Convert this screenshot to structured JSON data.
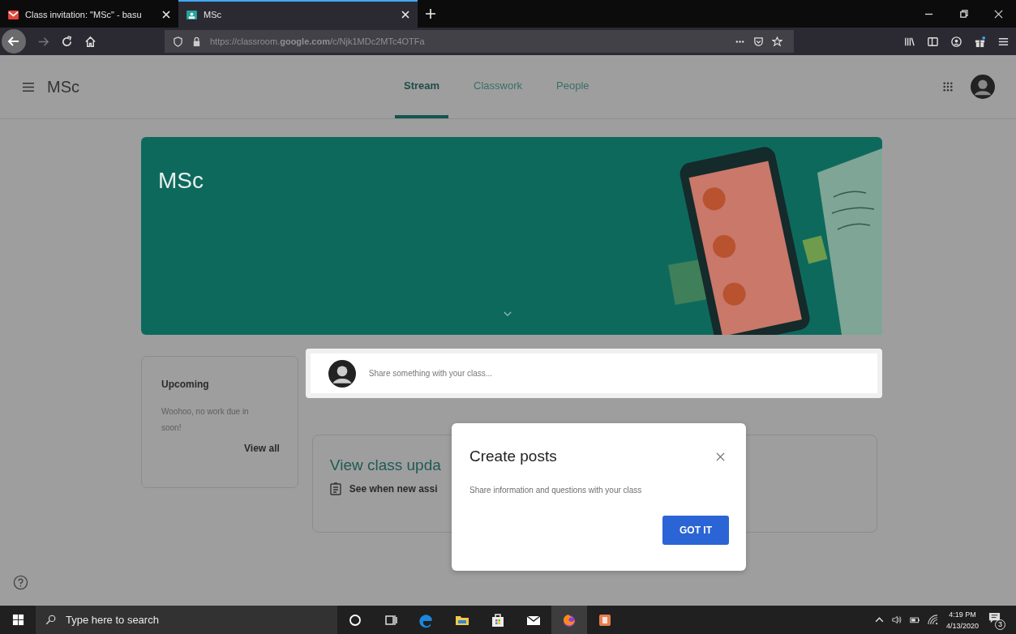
{
  "browser": {
    "tabs": [
      {
        "title": "Class invitation: \"MSc\" - basu",
        "selected": false
      },
      {
        "title": "MSc",
        "selected": true
      }
    ],
    "url": "https://classroom.**google.com**/c/Njk1MDc2MTc4OTFa"
  },
  "header": {
    "class_name": "MSc",
    "tabs": [
      {
        "label": "Stream",
        "selected": true
      },
      {
        "label": "Classwork",
        "selected": false
      },
      {
        "label": "People",
        "selected": false
      }
    ]
  },
  "banner": {
    "title": "MSc"
  },
  "upcoming": {
    "title": "Upcoming",
    "message": "Woohoo, no work due in soon!",
    "link": "View all"
  },
  "share": {
    "placeholder": "Share something with your class..."
  },
  "updates": {
    "title": "View class upda",
    "text": "See when new assi"
  },
  "dialog": {
    "title": "Create posts",
    "text": "Share information and questions with your class",
    "button": "GOT IT"
  },
  "taskbar": {
    "search_placeholder": "Type here to search",
    "time": "4:19 PM",
    "date": "4/13/2020",
    "notification_count": "3"
  }
}
